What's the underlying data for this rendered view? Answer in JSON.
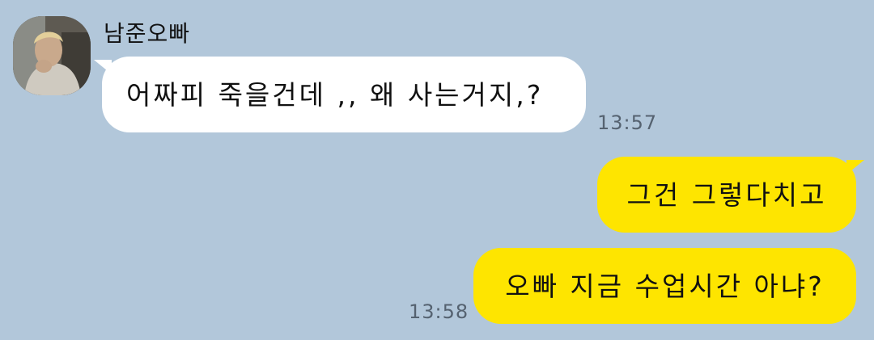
{
  "chat": {
    "sender_name": "남준오빠",
    "messages": [
      {
        "direction": "incoming",
        "text": "어짜피 죽을건데 ,, 왜 사는거지,?"
      },
      {
        "direction": "outgoing",
        "text": "그건 그렇다치고"
      },
      {
        "direction": "outgoing",
        "text": "오빠 지금 수업시간 아냐?"
      }
    ],
    "timestamps": [
      "13:57",
      "13:58"
    ]
  },
  "colors": {
    "background": "#b2c7da",
    "incoming_bubble": "#ffffff",
    "outgoing_bubble": "#fee500",
    "timestamp_text": "#556270"
  }
}
